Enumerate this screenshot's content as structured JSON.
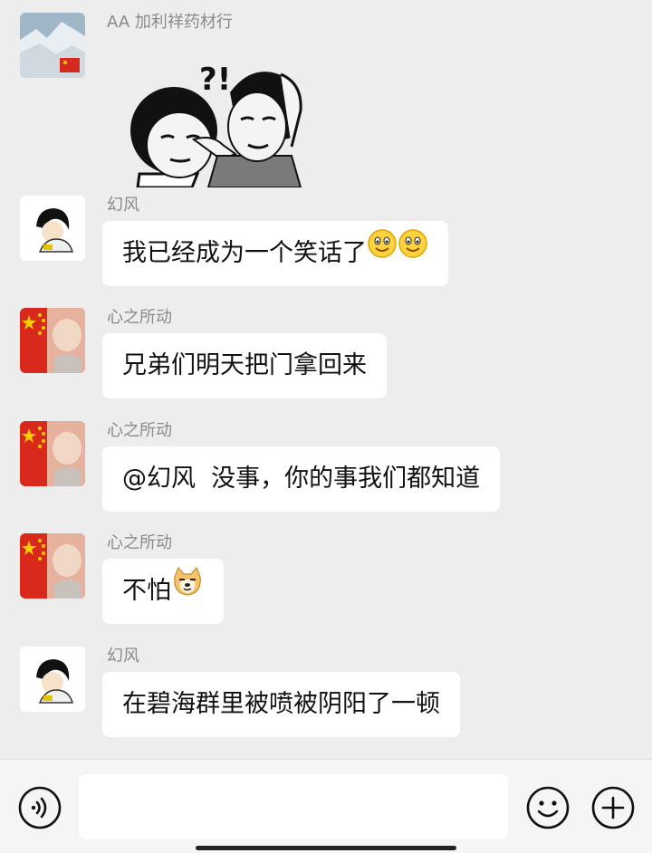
{
  "messages": [
    {
      "sender": "AA 加利祥药材行",
      "type": "sticker",
      "sticker_text": "?!"
    },
    {
      "sender": "幻风",
      "type": "text",
      "text": "我已经成为一个笑话了",
      "emojis": [
        "smile-emoji",
        "smile-emoji"
      ]
    },
    {
      "sender": "心之所动",
      "type": "text",
      "text": "兄弟们明天把门拿回来"
    },
    {
      "sender": "心之所动",
      "type": "text",
      "text": "@幻风  没事，你的事我们都知道"
    },
    {
      "sender": "心之所动",
      "type": "text",
      "text": "不怕",
      "emojis": [
        "doge-emoji"
      ]
    },
    {
      "sender": "幻风",
      "type": "text",
      "text": "在碧海群里被喷被阴阳了一顿"
    }
  ],
  "input_bar": {
    "voice_icon": "voice-icon",
    "emoji_icon": "emoji-icon",
    "plus_icon": "plus-icon",
    "text_value": ""
  }
}
